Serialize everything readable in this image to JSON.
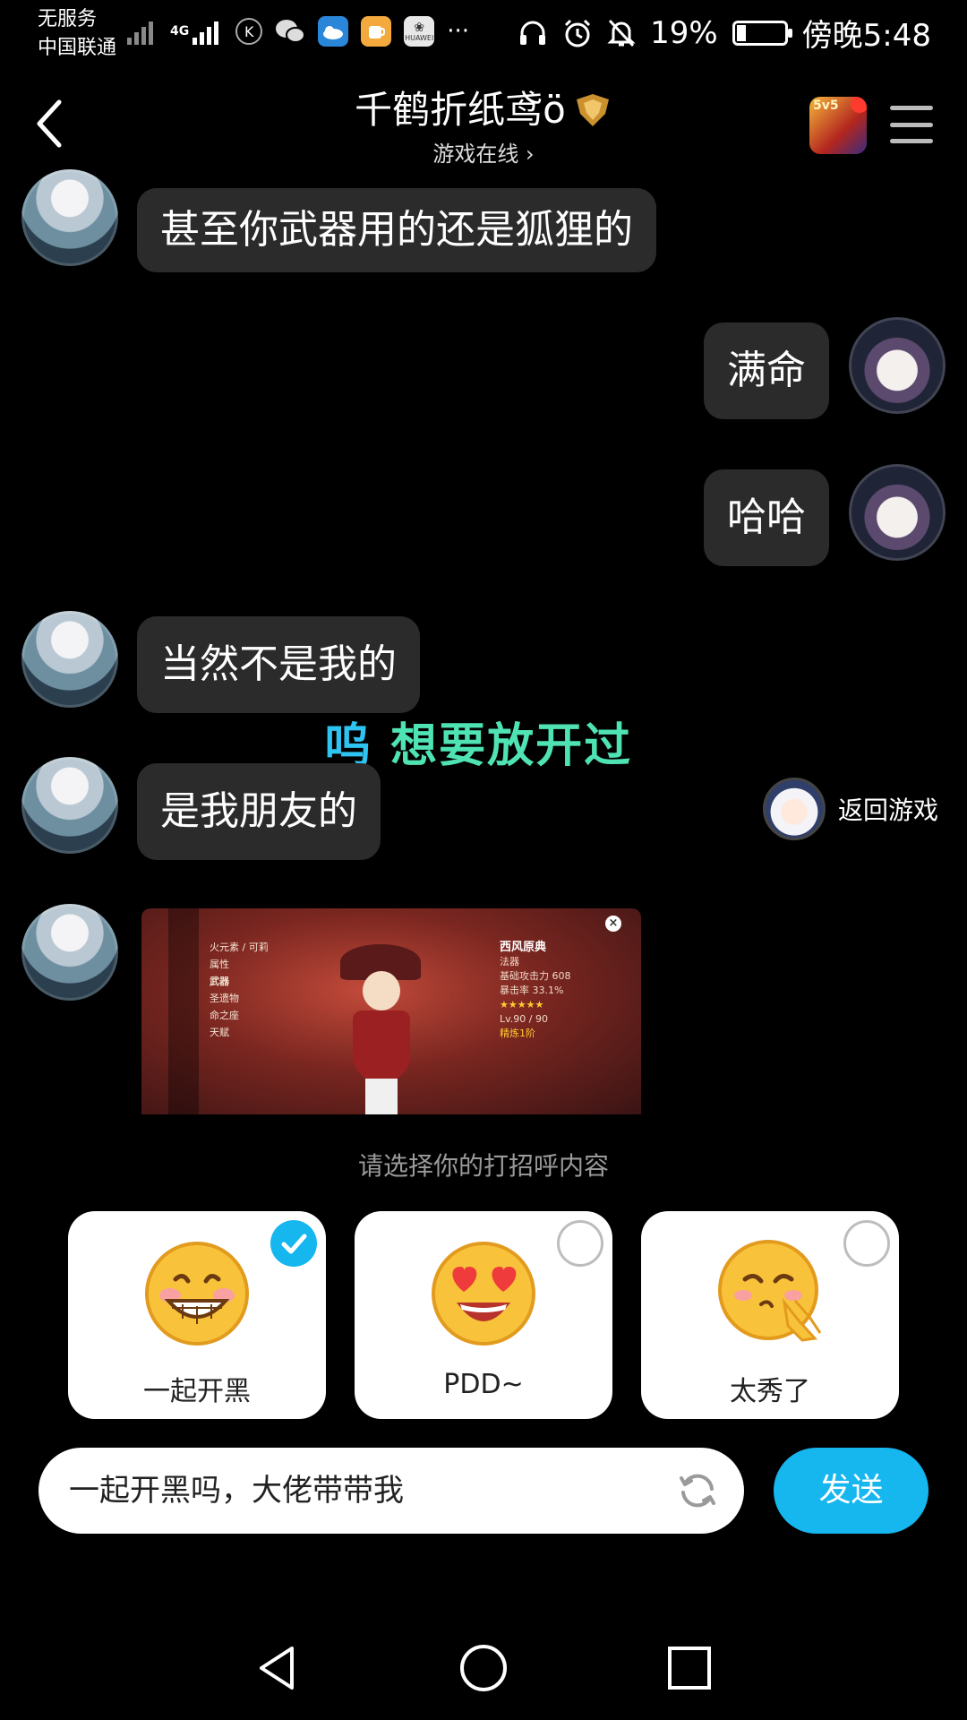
{
  "status_bar": {
    "carrier_line1": "无服务",
    "carrier_line2": "中国联通",
    "network": "4G",
    "battery": "19%",
    "battery_level": 0.19,
    "time": "傍晚5:48",
    "icons": [
      "signal-x-icon",
      "signal-4g-icon",
      "kugou-icon",
      "wechat-icon",
      "weather-icon",
      "app-icon",
      "huawei-icon",
      "more-dots-icon",
      "headphones-icon",
      "alarm-icon",
      "mute-icon",
      "battery-icon"
    ],
    "more": "···",
    "huawei_label": "HUAWEI"
  },
  "header": {
    "title": "千鹤折纸鸢ö",
    "subtitle": "游戏在线 ›",
    "game_badge": "5v5"
  },
  "messages": [
    {
      "side": "left",
      "text": "甚至你武器用的还是狐狸的"
    },
    {
      "side": "right",
      "text": "满命"
    },
    {
      "side": "right",
      "text": "哈哈"
    },
    {
      "side": "left",
      "text": "当然不是我的"
    },
    {
      "side": "left",
      "text": "是我朋友的"
    },
    {
      "side": "left",
      "type": "image"
    }
  ],
  "lyric": {
    "part1": "呜",
    "part2": "想要放开过"
  },
  "back_to_game": "返回游戏",
  "screenshot": {
    "menu": [
      "火元素 / 可莉",
      "属性",
      "武器",
      "圣遗物",
      "命之座",
      "天赋"
    ],
    "weapon_name": "西风原典",
    "type": "法器",
    "stats": [
      "基础攻击力 608",
      "暴击率 33.1%"
    ],
    "level": "Lv.90 / 90",
    "refine": "精炼1阶",
    "close": "×"
  },
  "greeting_hint": "请选择你的打招呼内容",
  "greeting_options": [
    {
      "label": "一起开黑",
      "checked": true,
      "icon": "grinning-emoji-icon"
    },
    {
      "label": "PDD~",
      "checked": false,
      "icon": "heart-eyes-emoji-icon"
    },
    {
      "label": "太秀了",
      "checked": false,
      "icon": "applause-emoji-icon"
    }
  ],
  "input": {
    "value": "一起开黑吗，大佬带带我"
  },
  "send_label": "发送",
  "colors": {
    "accent": "#16b6ef",
    "bubble": "#2b2b2b",
    "lyric_green": "#4fe3b4",
    "lyric_blue": "#2ec3f0"
  }
}
